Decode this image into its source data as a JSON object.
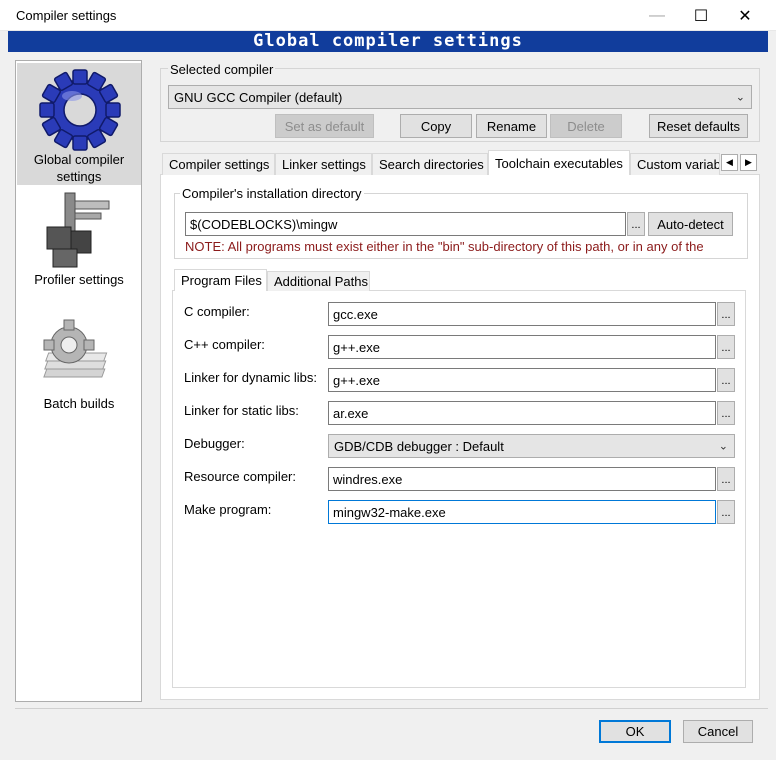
{
  "window": {
    "title": "Compiler settings",
    "minimize_glyph": "—",
    "maximize_glyph": "☐",
    "close_glyph": "✕"
  },
  "banner": {
    "title": "Global compiler settings"
  },
  "sidebar": {
    "items": [
      {
        "label": "Global compiler settings",
        "icon": "gear-icon",
        "selected": true
      },
      {
        "label": "Profiler settings",
        "icon": "caliper-icon",
        "selected": false
      },
      {
        "label": "Batch builds",
        "icon": "batch-gear-icon",
        "selected": false
      }
    ]
  },
  "selected_compiler": {
    "group_label": "Selected compiler",
    "value": "GNU GCC Compiler (default)",
    "buttons": {
      "set_default": "Set as default",
      "copy": "Copy",
      "rename": "Rename",
      "delete": "Delete",
      "reset_defaults": "Reset defaults"
    }
  },
  "tabs": [
    {
      "label": "Compiler settings",
      "active": false
    },
    {
      "label": "Linker settings",
      "active": false
    },
    {
      "label": "Search directories",
      "active": false
    },
    {
      "label": "Toolchain executables",
      "active": true
    },
    {
      "label": "Custom variab",
      "active": false
    }
  ],
  "tab_scroll": {
    "left": "◀",
    "right": "▶"
  },
  "install_dir": {
    "group_label": "Compiler's installation directory",
    "value": "$(CODEBLOCKS)\\mingw",
    "browse_label": "...",
    "autodetect_label": "Auto-detect",
    "note": "NOTE: All programs must exist either in the \"bin\" sub-directory of this path, or in any of the"
  },
  "sub_tabs": [
    {
      "label": "Program Files",
      "active": true
    },
    {
      "label": "Additional Paths",
      "active": false
    }
  ],
  "programs": {
    "browse_label": "...",
    "c_compiler": {
      "label": "C compiler:",
      "value": "gcc.exe"
    },
    "cpp_compiler": {
      "label": "C++ compiler:",
      "value": "g++.exe"
    },
    "linker_dynamic": {
      "label": "Linker for dynamic libs:",
      "value": "g++.exe"
    },
    "linker_static": {
      "label": "Linker for static libs:",
      "value": "ar.exe"
    },
    "debugger": {
      "label": "Debugger:",
      "value": "GDB/CDB debugger : Default"
    },
    "resource_compiler": {
      "label": "Resource compiler:",
      "value": "windres.exe"
    },
    "make_program": {
      "label": "Make program:",
      "value": "mingw32-make.exe"
    }
  },
  "footer": {
    "ok": "OK",
    "cancel": "Cancel"
  },
  "colors": {
    "banner": "#113d9c",
    "note": "#8b1a1a",
    "focus": "#0078d7"
  }
}
